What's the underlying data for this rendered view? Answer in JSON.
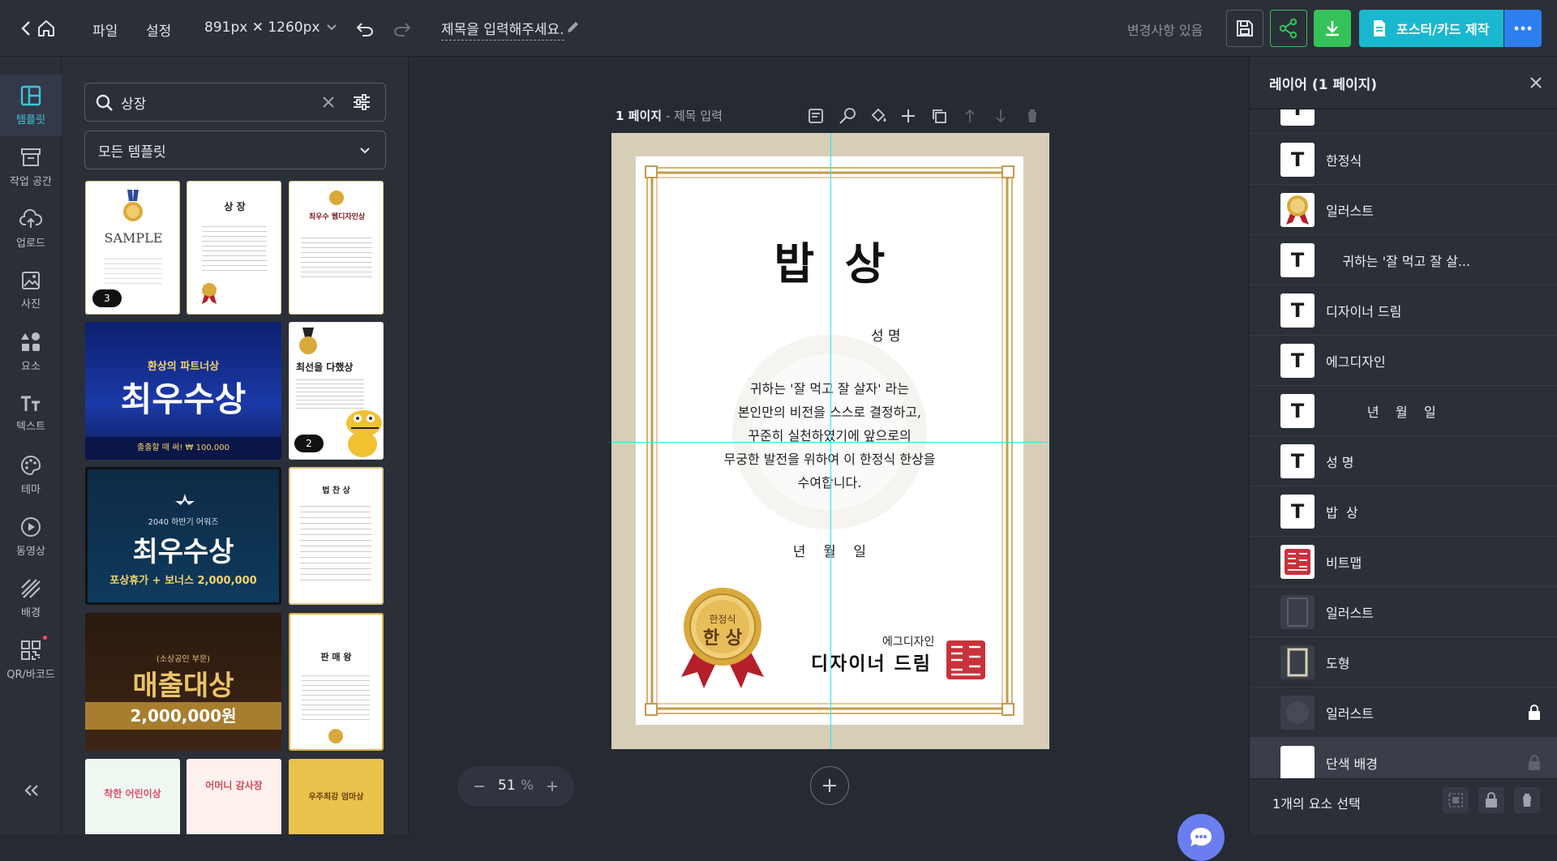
{
  "topbar": {
    "menu_file": "파일",
    "menu_settings": "설정",
    "size_label": "891px ✕ 1260px",
    "doc_title": "제목을 입력해주세요.",
    "status": "변경사항 있음",
    "make_button": "포스터/카드 제작"
  },
  "sidebar": {
    "items": [
      {
        "label": "템플릿",
        "icon": "template-icon"
      },
      {
        "label": "작업 공간",
        "icon": "archive-icon"
      },
      {
        "label": "업로드",
        "icon": "upload-icon"
      },
      {
        "label": "사진",
        "icon": "photo-icon"
      },
      {
        "label": "요소",
        "icon": "elements-icon"
      },
      {
        "label": "텍스트",
        "icon": "text-icon"
      },
      {
        "label": "테마",
        "icon": "palette-icon"
      },
      {
        "label": "동영상",
        "icon": "video-icon"
      },
      {
        "label": "배경",
        "icon": "background-icon"
      },
      {
        "label": "QR/바코드",
        "icon": "qr-icon"
      }
    ]
  },
  "panel": {
    "search_value": "상장",
    "filter_value": "모든 템플릿",
    "thumbs": {
      "t1_text": "SAMPLE",
      "t1_badge": "3",
      "t2_title": "상 장",
      "t3_title": "최우수 웹디자인상",
      "t4_sub": "환상의 파트너상",
      "t4_title": "최우수상",
      "t4_footer": "출출할 때 써! ₩ 100,000",
      "t5_title": "최선을 다했상",
      "t5_badge": "2",
      "t6_sub": "2040 하반기 어워즈",
      "t6_title": "최우수상",
      "t6_footer": "포상휴가 + 보너스 2,000,000",
      "t7_sub": "(소상공인 부문)",
      "t7_title": "매출대상",
      "t7_amount": "2,000,000원",
      "t8_title": "법 찬 상",
      "t9_title": "판 매 왕",
      "t10_title": "착한 어린이상",
      "t11_title": "어머니 감사장",
      "t12_title": "우주최강 엄마상"
    }
  },
  "canvas": {
    "page_label": "1 페이지",
    "page_title": " - 제목 입력",
    "zoom_value": "51",
    "zoom_unit": "%",
    "cert": {
      "title": "밥  상",
      "name_label": "성 명",
      "body": [
        "귀하는 '잘 먹고 잘 살자' 라는",
        "본인만의 비전을 스스로 결정하고,",
        "꾸준히 실천하였기에 앞으로의",
        "무궁한 발전을 위하여 이 한정식 한상을",
        "수여합니다."
      ],
      "date": "년    월    일",
      "medal_top": "한정식",
      "medal_main": "한 상",
      "org": "에그디자인",
      "signer": "디자이너 드림"
    }
  },
  "layers": {
    "title": "레이어 (1 페이지)",
    "items": [
      {
        "name": "한정식",
        "type": "text"
      },
      {
        "name": "일러스트",
        "type": "medal"
      },
      {
        "name": "    귀하는 '잘 먹고 잘 살...",
        "type": "text"
      },
      {
        "name": "디자이너 드림",
        "type": "text"
      },
      {
        "name": "에그디자인",
        "type": "text"
      },
      {
        "name": "          년    월    일",
        "type": "text"
      },
      {
        "name": "성 명",
        "type": "text"
      },
      {
        "name": "밥  상",
        "type": "text"
      },
      {
        "name": "비트맵",
        "type": "bitmap"
      },
      {
        "name": "일러스트",
        "type": "dark"
      },
      {
        "name": "도형",
        "type": "frame"
      },
      {
        "name": "일러스트",
        "type": "seal"
      },
      {
        "name": "단색 배경",
        "type": "white"
      }
    ],
    "footer": "1개의 요소 선택"
  },
  "colors": {
    "accent": "#19b8d0",
    "green": "#34c259",
    "blue": "#2d7ff0",
    "gold": "#c9a24a"
  }
}
